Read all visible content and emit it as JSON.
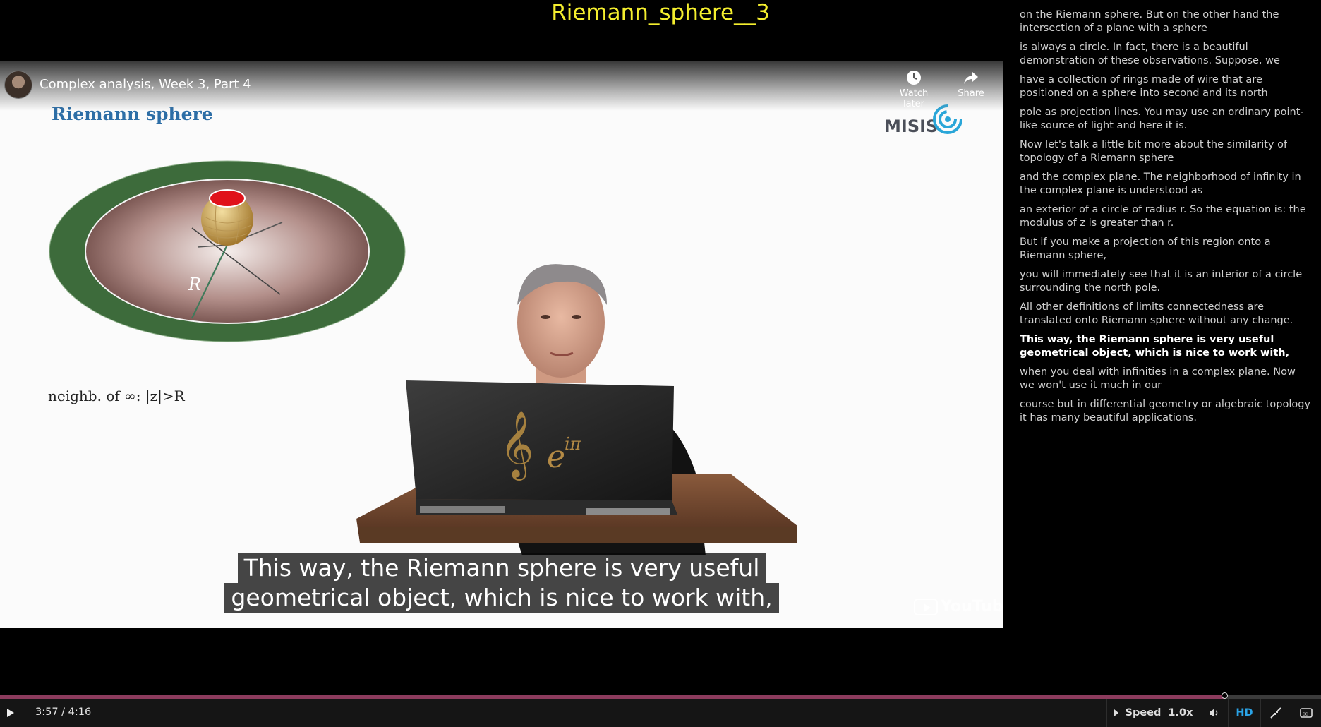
{
  "page_title": "Riemann_sphere__3",
  "video": {
    "title": "Complex analysis, Week 3, Part 4",
    "watch_later_label": "Watch later",
    "share_label": "Share",
    "slide_heading": "Riemann sphere",
    "logo_text": "MISIS",
    "figure_label": "R",
    "slide_formula": "neighb. of ∞: |z|>R",
    "laptop_formula": "e",
    "laptop_exponent": "iπ",
    "caption_lines": [
      "This way, the Riemann sphere is very useful",
      "geometrical object, which is nice to work with,"
    ],
    "youtube_mark": "YouTube"
  },
  "transcript": {
    "items": [
      "on the Riemann sphere. But on the other hand the intersection of a plane with a sphere",
      "is always a circle. In fact, there is a beautiful demonstration of these observations. Suppose, we",
      "have a collection of rings made of wire that are positioned on a sphere into second and its north",
      "pole as projection lines. You may use an ordinary point-like source of light and here it is.",
      "Now let's talk a little bit more about the similarity of topology of a Riemann sphere",
      "and the complex plane. The neighborhood of infinity in the complex plane is understood as",
      "an exterior of a circle of radius r. So the equation is: the modulus of z is greater than r.",
      "But if you make a projection of this region onto a Riemann sphere,",
      "you will immediately see that it is an interior of a circle surrounding the north pole.",
      "All other definitions of limits connectedness are translated onto Riemann sphere without any change.",
      "This way, the Riemann sphere is very useful geometrical object, which is nice to work with,",
      "when you deal with infinities in a complex plane. Now we won't use it much in our",
      "course but in differential geometry or algebraic topology it has many beautiful applications."
    ],
    "active_index": 10
  },
  "controls": {
    "time": "3:57 / 4:16",
    "progress_fraction": 0.927,
    "speed_label": "Speed",
    "speed_value": "1.0x",
    "hd_label": "HD"
  },
  "colors": {
    "title_yellow": "#f4ee2e",
    "progress": "#8c3b5d",
    "hd_blue": "#2aa3e6",
    "heading_blue": "#2d6ea6"
  }
}
